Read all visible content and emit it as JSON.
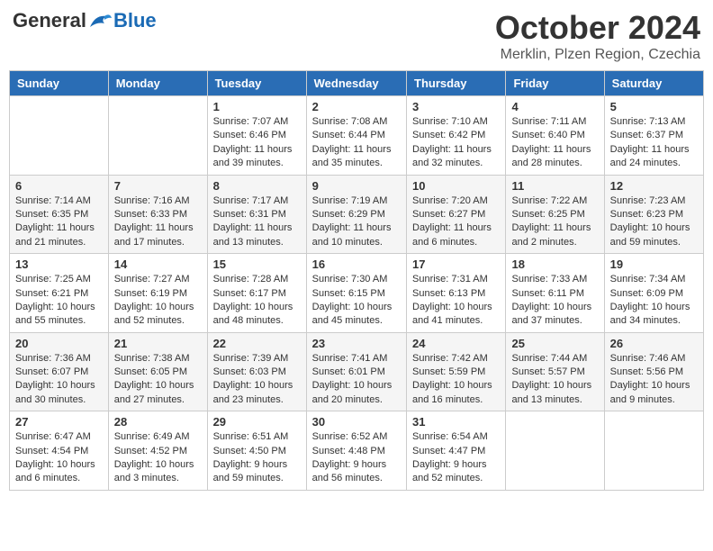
{
  "header": {
    "logo_general": "General",
    "logo_blue": "Blue",
    "title": "October 2024",
    "location": "Merklin, Plzen Region, Czechia"
  },
  "days_of_week": [
    "Sunday",
    "Monday",
    "Tuesday",
    "Wednesday",
    "Thursday",
    "Friday",
    "Saturday"
  ],
  "weeks": [
    [
      {
        "day": "",
        "content": ""
      },
      {
        "day": "",
        "content": ""
      },
      {
        "day": "1",
        "content": "Sunrise: 7:07 AM\nSunset: 6:46 PM\nDaylight: 11 hours and 39 minutes."
      },
      {
        "day": "2",
        "content": "Sunrise: 7:08 AM\nSunset: 6:44 PM\nDaylight: 11 hours and 35 minutes."
      },
      {
        "day": "3",
        "content": "Sunrise: 7:10 AM\nSunset: 6:42 PM\nDaylight: 11 hours and 32 minutes."
      },
      {
        "day": "4",
        "content": "Sunrise: 7:11 AM\nSunset: 6:40 PM\nDaylight: 11 hours and 28 minutes."
      },
      {
        "day": "5",
        "content": "Sunrise: 7:13 AM\nSunset: 6:37 PM\nDaylight: 11 hours and 24 minutes."
      }
    ],
    [
      {
        "day": "6",
        "content": "Sunrise: 7:14 AM\nSunset: 6:35 PM\nDaylight: 11 hours and 21 minutes."
      },
      {
        "day": "7",
        "content": "Sunrise: 7:16 AM\nSunset: 6:33 PM\nDaylight: 11 hours and 17 minutes."
      },
      {
        "day": "8",
        "content": "Sunrise: 7:17 AM\nSunset: 6:31 PM\nDaylight: 11 hours and 13 minutes."
      },
      {
        "day": "9",
        "content": "Sunrise: 7:19 AM\nSunset: 6:29 PM\nDaylight: 11 hours and 10 minutes."
      },
      {
        "day": "10",
        "content": "Sunrise: 7:20 AM\nSunset: 6:27 PM\nDaylight: 11 hours and 6 minutes."
      },
      {
        "day": "11",
        "content": "Sunrise: 7:22 AM\nSunset: 6:25 PM\nDaylight: 11 hours and 2 minutes."
      },
      {
        "day": "12",
        "content": "Sunrise: 7:23 AM\nSunset: 6:23 PM\nDaylight: 10 hours and 59 minutes."
      }
    ],
    [
      {
        "day": "13",
        "content": "Sunrise: 7:25 AM\nSunset: 6:21 PM\nDaylight: 10 hours and 55 minutes."
      },
      {
        "day": "14",
        "content": "Sunrise: 7:27 AM\nSunset: 6:19 PM\nDaylight: 10 hours and 52 minutes."
      },
      {
        "day": "15",
        "content": "Sunrise: 7:28 AM\nSunset: 6:17 PM\nDaylight: 10 hours and 48 minutes."
      },
      {
        "day": "16",
        "content": "Sunrise: 7:30 AM\nSunset: 6:15 PM\nDaylight: 10 hours and 45 minutes."
      },
      {
        "day": "17",
        "content": "Sunrise: 7:31 AM\nSunset: 6:13 PM\nDaylight: 10 hours and 41 minutes."
      },
      {
        "day": "18",
        "content": "Sunrise: 7:33 AM\nSunset: 6:11 PM\nDaylight: 10 hours and 37 minutes."
      },
      {
        "day": "19",
        "content": "Sunrise: 7:34 AM\nSunset: 6:09 PM\nDaylight: 10 hours and 34 minutes."
      }
    ],
    [
      {
        "day": "20",
        "content": "Sunrise: 7:36 AM\nSunset: 6:07 PM\nDaylight: 10 hours and 30 minutes."
      },
      {
        "day": "21",
        "content": "Sunrise: 7:38 AM\nSunset: 6:05 PM\nDaylight: 10 hours and 27 minutes."
      },
      {
        "day": "22",
        "content": "Sunrise: 7:39 AM\nSunset: 6:03 PM\nDaylight: 10 hours and 23 minutes."
      },
      {
        "day": "23",
        "content": "Sunrise: 7:41 AM\nSunset: 6:01 PM\nDaylight: 10 hours and 20 minutes."
      },
      {
        "day": "24",
        "content": "Sunrise: 7:42 AM\nSunset: 5:59 PM\nDaylight: 10 hours and 16 minutes."
      },
      {
        "day": "25",
        "content": "Sunrise: 7:44 AM\nSunset: 5:57 PM\nDaylight: 10 hours and 13 minutes."
      },
      {
        "day": "26",
        "content": "Sunrise: 7:46 AM\nSunset: 5:56 PM\nDaylight: 10 hours and 9 minutes."
      }
    ],
    [
      {
        "day": "27",
        "content": "Sunrise: 6:47 AM\nSunset: 4:54 PM\nDaylight: 10 hours and 6 minutes."
      },
      {
        "day": "28",
        "content": "Sunrise: 6:49 AM\nSunset: 4:52 PM\nDaylight: 10 hours and 3 minutes."
      },
      {
        "day": "29",
        "content": "Sunrise: 6:51 AM\nSunset: 4:50 PM\nDaylight: 9 hours and 59 minutes."
      },
      {
        "day": "30",
        "content": "Sunrise: 6:52 AM\nSunset: 4:48 PM\nDaylight: 9 hours and 56 minutes."
      },
      {
        "day": "31",
        "content": "Sunrise: 6:54 AM\nSunset: 4:47 PM\nDaylight: 9 hours and 52 minutes."
      },
      {
        "day": "",
        "content": ""
      },
      {
        "day": "",
        "content": ""
      }
    ]
  ]
}
